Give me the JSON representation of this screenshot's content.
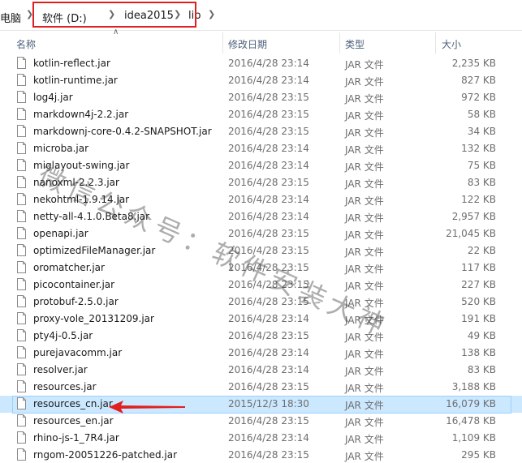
{
  "address_bar": {
    "pc_label": "电脑",
    "crumbs": [
      "软件 (D:)",
      "idea2015",
      "lib"
    ]
  },
  "columns": {
    "name": "名称",
    "date": "修改日期",
    "type": "类型",
    "size": "大小"
  },
  "files": [
    {
      "name": "kotlin-reflect.jar",
      "date": "2016/4/28 23:14",
      "type": "JAR 文件",
      "size": "2,235 KB"
    },
    {
      "name": "kotlin-runtime.jar",
      "date": "2016/4/28 23:14",
      "type": "JAR 文件",
      "size": "827 KB"
    },
    {
      "name": "log4j.jar",
      "date": "2016/4/28 23:15",
      "type": "JAR 文件",
      "size": "972 KB"
    },
    {
      "name": "markdown4j-2.2.jar",
      "date": "2016/4/28 23:15",
      "type": "JAR 文件",
      "size": "58 KB"
    },
    {
      "name": "markdownj-core-0.4.2-SNAPSHOT.jar",
      "date": "2016/4/28 23:15",
      "type": "JAR 文件",
      "size": "34 KB"
    },
    {
      "name": "microba.jar",
      "date": "2016/4/28 23:14",
      "type": "JAR 文件",
      "size": "132 KB"
    },
    {
      "name": "miglayout-swing.jar",
      "date": "2016/4/28 23:14",
      "type": "JAR 文件",
      "size": "75 KB"
    },
    {
      "name": "nanoxml-2.2.3.jar",
      "date": "2016/4/28 23:15",
      "type": "JAR 文件",
      "size": "83 KB"
    },
    {
      "name": "nekohtml-1.9.14.jar",
      "date": "2016/4/28 23:14",
      "type": "JAR 文件",
      "size": "122 KB"
    },
    {
      "name": "netty-all-4.1.0.Beta8.jar",
      "date": "2016/4/28 23:14",
      "type": "JAR 文件",
      "size": "2,957 KB"
    },
    {
      "name": "openapi.jar",
      "date": "2016/4/28 23:15",
      "type": "JAR 文件",
      "size": "21,045 KB"
    },
    {
      "name": "optimizedFileManager.jar",
      "date": "2016/4/28 23:15",
      "type": "JAR 文件",
      "size": "22 KB"
    },
    {
      "name": "oromatcher.jar",
      "date": "2016/4/28 23:15",
      "type": "JAR 文件",
      "size": "117 KB"
    },
    {
      "name": "picocontainer.jar",
      "date": "2016/4/28 23:15",
      "type": "JAR 文件",
      "size": "227 KB"
    },
    {
      "name": "protobuf-2.5.0.jar",
      "date": "2016/4/28 23:15",
      "type": "JAR 文件",
      "size": "520 KB"
    },
    {
      "name": "proxy-vole_20131209.jar",
      "date": "2016/4/28 23:14",
      "type": "JAR 文件",
      "size": "191 KB"
    },
    {
      "name": "pty4j-0.5.jar",
      "date": "2016/4/28 23:15",
      "type": "JAR 文件",
      "size": "49 KB"
    },
    {
      "name": "purejavacomm.jar",
      "date": "2016/4/28 23:14",
      "type": "JAR 文件",
      "size": "138 KB"
    },
    {
      "name": "resolver.jar",
      "date": "2016/4/28 23:14",
      "type": "JAR 文件",
      "size": "83 KB"
    },
    {
      "name": "resources.jar",
      "date": "2016/4/28 23:15",
      "type": "JAR 文件",
      "size": "3,188 KB"
    },
    {
      "name": "resources_cn.jar",
      "date": "2015/12/3 18:30",
      "type": "JAR 文件",
      "size": "16,079 KB",
      "selected": true
    },
    {
      "name": "resources_en.jar",
      "date": "2016/4/28 23:15",
      "type": "JAR 文件",
      "size": "16,478 KB"
    },
    {
      "name": "rhino-js-1_7R4.jar",
      "date": "2016/4/28 23:14",
      "type": "JAR 文件",
      "size": "1,109 KB"
    },
    {
      "name": "rngom-20051226-patched.jar",
      "date": "2016/4/28 23:15",
      "type": "JAR 文件",
      "size": "295 KB"
    }
  ],
  "watermark": "微信公众号：软件安装大神",
  "colors": {
    "selection_bg": "#cce8ff",
    "selection_border": "#99d1ff",
    "highlight_red": "#e02020",
    "header_text": "#4c607a"
  },
  "icons": {
    "file": "file-icon",
    "chevron": "chevron-right-icon",
    "sort": "sort-up-icon"
  }
}
